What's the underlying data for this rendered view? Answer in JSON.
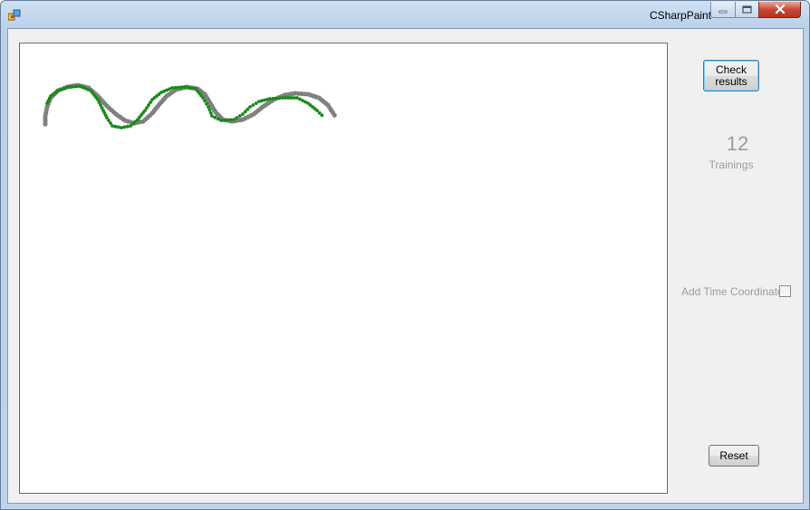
{
  "window": {
    "title": "CSharpPaint"
  },
  "icons": {
    "app": "app-icon",
    "minimize": "minimize-icon",
    "maximize": "maximize-icon",
    "close": "close-icon"
  },
  "colors": {
    "reference_stroke": "#808080",
    "user_stroke": "#168a16",
    "close_button": "#c7483a"
  },
  "side_panel": {
    "check_button_label": "Check\nresults",
    "training_count": "12",
    "training_label": "Trainings",
    "time_coordinate_label": "Add Time Coordinate",
    "time_coordinate_checked": false,
    "reset_button_label": "Reset"
  }
}
